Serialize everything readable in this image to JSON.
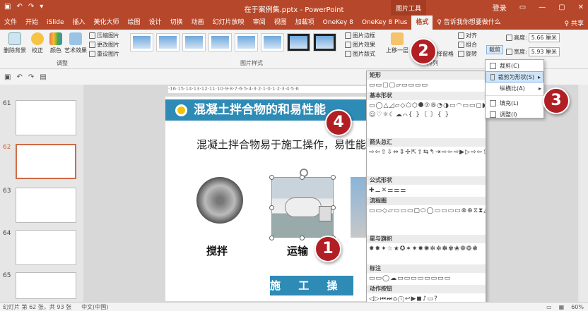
{
  "titlebar": {
    "filename": "在于案例集.pptx  -  PowerPoint",
    "picture_tools": "图片工具",
    "login": "登录",
    "quick_access": [
      "↶",
      "↷",
      "▾"
    ],
    "window_controls": [
      "—",
      "▢",
      "✕"
    ]
  },
  "tabs": [
    "文件",
    "开始",
    "iSlide",
    "插入",
    "美化大师",
    "绘图",
    "设计",
    "切换",
    "动画",
    "幻灯片放映",
    "审阅",
    "视图",
    "加载项",
    "OneKey 8",
    "OneKey 8 Plus",
    "格式"
  ],
  "tell_me": "♀ 告诉我你想要做什么",
  "share": "♀ 共享",
  "ribbon": {
    "adjust": {
      "remove_bg": "删除背景",
      "correct": "校正",
      "color": "颜色",
      "artistic": "艺术效果",
      "compress": "压缩图片",
      "change": "更改图片",
      "reset": "重设图片",
      "label": "调整"
    },
    "styles": {
      "border": "图片边框",
      "effects": "图片效果",
      "layout": "图片版式",
      "label": "图片样式"
    },
    "arrange": {
      "bring_forward": "上移一层",
      "selection_pane": "择窗格",
      "align": "对齐",
      "group": "组合",
      "rotate": "旋转",
      "label": "排列"
    },
    "size": {
      "crop": "裁剪",
      "height_label": "高度:",
      "height": "5.66 厘米",
      "width_label": "宽度:",
      "width": "5.93 厘米",
      "label": "大小"
    }
  },
  "ruler": "·16·15·14·13·12·11·10·9·8·7·6·5·4·3·2·1·0·1·2·3·4·5·6",
  "thumbnails": [
    {
      "num": "61"
    },
    {
      "num": "62"
    },
    {
      "num": "63"
    },
    {
      "num": "64"
    },
    {
      "num": "65"
    }
  ],
  "slide": {
    "title": "混凝土拌合物的和易性能",
    "body": "混凝土拌合物易于施工操作，易性能，凝土性能。",
    "captions": [
      "搅拌",
      "运输"
    ],
    "banner": "施 工 操 作"
  },
  "gallery": {
    "sections": [
      {
        "name": "矩形",
        "shapes": "▭▭▢▢▱▭▭▭▭"
      },
      {
        "name": "基本形状",
        "shapes": "▭◯△◿▱◇⬠⬡⯃⑦⑧◔◑▭◠▭▭◻◗◉▭▯◷▭◈☺♡☼☾☁⌒{ }〔 〕{ }"
      },
      {
        "name": "箭头总汇",
        "shapes": "⇨⇦⇧⇩⇔⇕✢⇱⇧⇆↰⇥⇨⇦⇨▶▷⇨⇦⇧⇩⇔⇕✢⇱⇧⇆↰"
      },
      {
        "name": "公式形状",
        "shapes": "✚⚊✕⚌⚌⚌"
      },
      {
        "name": "流程图",
        "shapes": "▭▭◇▱▭▭▭▢⬭◯▭▭▭▭⊗⊕⧖⧗△▽◺▭◗◯"
      },
      {
        "name": "星与旗帜",
        "shapes": "✸✸✦☆★✪✶✷✹✺✻✼✽✾❀❁❂❃"
      },
      {
        "name": "标注",
        "shapes": "▭▭◯☁▭▭▭▭▭▭▭▭"
      },
      {
        "name": "动作按钮",
        "shapes": "◁▷⏮⏭⌂ⓘ↩▶◼♪▭?"
      }
    ]
  },
  "crop_menu": {
    "crop": "裁剪(C)",
    "crop_to_shape": "裁剪为形状(S)",
    "aspect_ratio": "纵横比(A)",
    "fill": "填充(L)",
    "fit": "调整(I)"
  },
  "badges": [
    "1",
    "2",
    "3",
    "4"
  ],
  "status": {
    "slide_info": "幻灯片 第 62 张，共 93 张",
    "language": "中文(中国)",
    "zoom": "60%"
  },
  "colors": {
    "accent": "#b7472a",
    "slide_blue": "#2e8bb6",
    "badge_red": "#b11f24"
  }
}
